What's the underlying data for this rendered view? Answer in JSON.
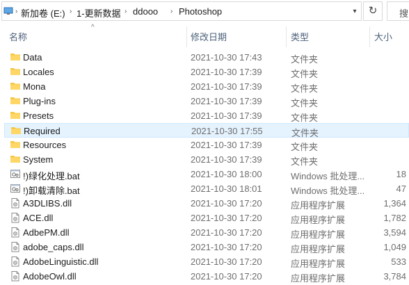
{
  "address": {
    "crumbs": [
      "新加卷 (E:)",
      "1-更新数据",
      "ddooo",
      "Photoshop"
    ],
    "search_label": "搜"
  },
  "columns": {
    "name": "名称",
    "date": "修改日期",
    "type": "类型",
    "size": "大小"
  },
  "files": [
    {
      "name": "Data",
      "date": "2021-10-30 17:43",
      "type": "文件夹",
      "size": "",
      "icon": "folder-icon"
    },
    {
      "name": "Locales",
      "date": "2021-10-30 17:39",
      "type": "文件夹",
      "size": "",
      "icon": "folder-icon"
    },
    {
      "name": "Mona",
      "date": "2021-10-30 17:39",
      "type": "文件夹",
      "size": "",
      "icon": "folder-icon"
    },
    {
      "name": "Plug-ins",
      "date": "2021-10-30 17:39",
      "type": "文件夹",
      "size": "",
      "icon": "folder-icon"
    },
    {
      "name": "Presets",
      "date": "2021-10-30 17:39",
      "type": "文件夹",
      "size": "",
      "icon": "folder-icon"
    },
    {
      "name": "Required",
      "date": "2021-10-30 17:55",
      "type": "文件夹",
      "size": "",
      "icon": "folder-icon",
      "selected": true
    },
    {
      "name": "Resources",
      "date": "2021-10-30 17:39",
      "type": "文件夹",
      "size": "",
      "icon": "folder-icon"
    },
    {
      "name": "System",
      "date": "2021-10-30 17:39",
      "type": "文件夹",
      "size": "",
      "icon": "folder-icon"
    },
    {
      "name": "!)绿化处理.bat",
      "date": "2021-10-30 18:00",
      "type": "Windows 批处理...",
      "size": "18",
      "icon": "batch-file-icon"
    },
    {
      "name": "!)卸载清除.bat",
      "date": "2021-10-30 18:01",
      "type": "Windows 批处理...",
      "size": "47",
      "icon": "batch-file-icon"
    },
    {
      "name": "A3DLIBS.dll",
      "date": "2021-10-30 17:20",
      "type": "应用程序扩展",
      "size": "1,364",
      "icon": "dll-file-icon"
    },
    {
      "name": "ACE.dll",
      "date": "2021-10-30 17:20",
      "type": "应用程序扩展",
      "size": "1,782",
      "icon": "dll-file-icon"
    },
    {
      "name": "AdbePM.dll",
      "date": "2021-10-30 17:20",
      "type": "应用程序扩展",
      "size": "3,594",
      "icon": "dll-file-icon"
    },
    {
      "name": "adobe_caps.dll",
      "date": "2021-10-30 17:20",
      "type": "应用程序扩展",
      "size": "1,049",
      "icon": "dll-file-icon"
    },
    {
      "name": "AdobeLinguistic.dll",
      "date": "2021-10-30 17:20",
      "type": "应用程序扩展",
      "size": "533",
      "icon": "dll-file-icon"
    },
    {
      "name": "AdobeOwl.dll",
      "date": "2021-10-30 17:20",
      "type": "应用程序扩展",
      "size": "3,784",
      "icon": "dll-file-icon"
    }
  ]
}
